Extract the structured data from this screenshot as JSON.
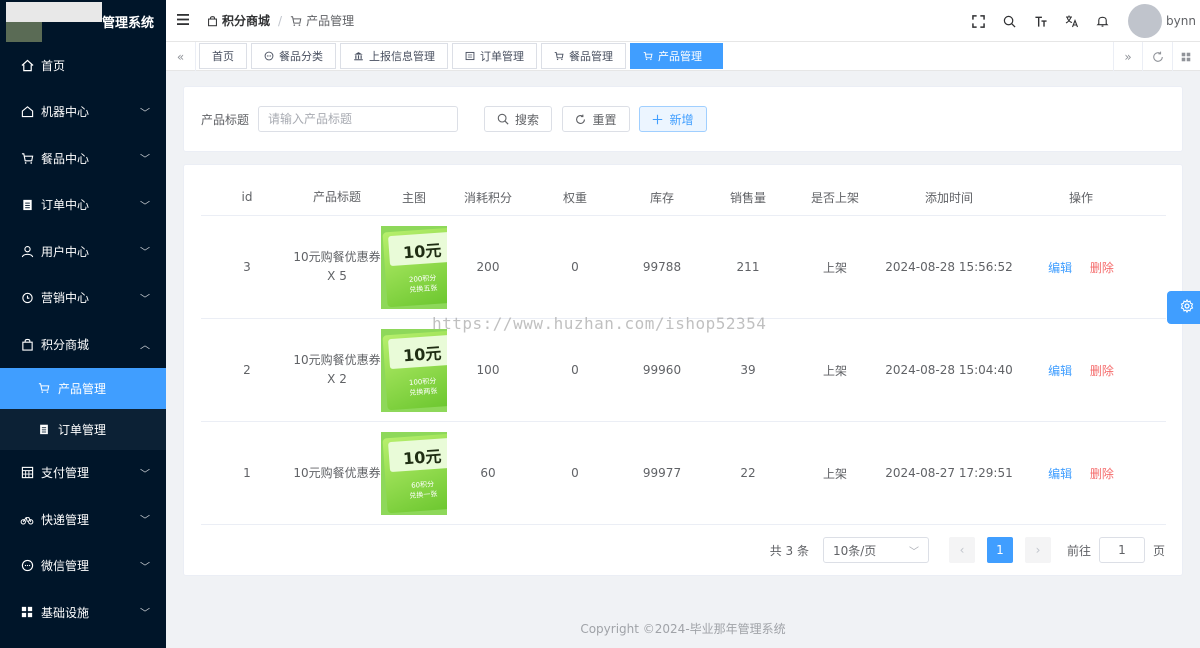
{
  "app": {
    "title": "管理系统"
  },
  "sidebar": {
    "items": [
      {
        "label": "首页",
        "icon": "home-icon"
      },
      {
        "label": "机器中心",
        "icon": "house-icon"
      },
      {
        "label": "餐品中心",
        "icon": "cart-icon"
      },
      {
        "label": "订单中心",
        "icon": "clipboard-icon"
      },
      {
        "label": "用户中心",
        "icon": "user-icon"
      },
      {
        "label": "营销中心",
        "icon": "alarm-clock-icon"
      },
      {
        "label": "积分商城",
        "icon": "bag-icon",
        "expanded": true
      },
      {
        "label": "支付管理",
        "icon": "calculator-icon"
      },
      {
        "label": "快递管理",
        "icon": "bicycle-icon"
      },
      {
        "label": "微信管理",
        "icon": "chat-icon"
      },
      {
        "label": "基础设施",
        "icon": "grid-icon"
      }
    ],
    "sub_items": [
      {
        "label": "产品管理",
        "icon": "cart-icon",
        "active": true
      },
      {
        "label": "订单管理",
        "icon": "clipboard-icon",
        "active": false
      }
    ]
  },
  "header": {
    "breadcrumb": [
      "积分商城",
      "产品管理"
    ],
    "username": "bynn"
  },
  "tags": [
    {
      "label": "首页",
      "icon": ""
    },
    {
      "label": "餐品分类",
      "icon": "chat-icon"
    },
    {
      "label": "上报信息管理",
      "icon": "bank-icon"
    },
    {
      "label": "订单管理",
      "icon": "tablet-icon"
    },
    {
      "label": "餐品管理",
      "icon": "cart-icon"
    },
    {
      "label": "产品管理",
      "icon": "cart-icon",
      "active": true
    }
  ],
  "search": {
    "label": "产品标题",
    "placeholder": "请输入产品标题",
    "value": "",
    "search_btn": "搜索",
    "reset_btn": "重置",
    "add_btn": "新增"
  },
  "table": {
    "columns": [
      "id",
      "产品标题",
      "主图",
      "消耗积分",
      "权重",
      "库存",
      "销售量",
      "是否上架",
      "添加时间",
      "操作"
    ],
    "rows": [
      {
        "id": "3",
        "title": "10元购餐优惠券 X 5",
        "image_text": "10元",
        "image_sub": "200积分\n兑换五张",
        "points": "200",
        "weight": "0",
        "stock": "99788",
        "sales": "211",
        "shelf": "上架",
        "time": "2024-08-28 15:56:52"
      },
      {
        "id": "2",
        "title": "10元购餐优惠券 X 2",
        "image_text": "10元",
        "image_sub": "100积分\n兑换两张",
        "points": "100",
        "weight": "0",
        "stock": "99960",
        "sales": "39",
        "shelf": "上架",
        "time": "2024-08-28 15:04:40"
      },
      {
        "id": "1",
        "title": "10元购餐优惠券",
        "image_text": "10元",
        "image_sub": "60积分\n兑换一张",
        "points": "60",
        "weight": "0",
        "stock": "99977",
        "sales": "22",
        "shelf": "上架",
        "time": "2024-08-27 17:29:51"
      }
    ],
    "op_edit": "编辑",
    "op_delete": "删除"
  },
  "pagination": {
    "total_text": "共 3 条",
    "page_size": "10条/页",
    "current": "1",
    "goto_label": "前往",
    "goto_value": "1",
    "page_suffix": "页"
  },
  "watermark": "https://www.huzhan.com/ishop52354",
  "footer": "Copyright ©2024-毕业那年管理系统",
  "colors": {
    "sidebar_bg": "#001529",
    "primary": "#409eff",
    "danger": "#f56c6c"
  }
}
